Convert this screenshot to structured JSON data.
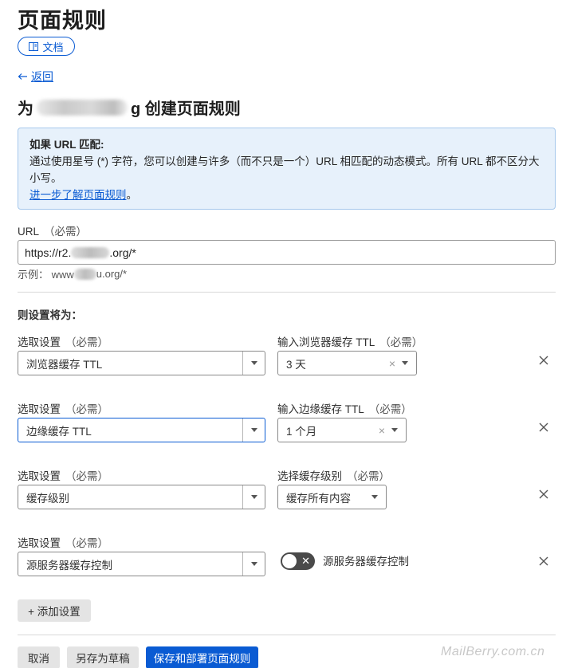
{
  "page": {
    "title": "页面规则",
    "docs_label": "文档",
    "back_label": "返回",
    "heading_prefix": "为",
    "heading_suffix": "g 创建页面规则"
  },
  "info": {
    "title": "如果 URL 匹配:",
    "body": "通过使用星号 (*) 字符，您可以创建与许多（而不只是一个）URL 相匹配的动态模式。所有 URL 都不区分大小写。",
    "link": "进一步了解页面规则",
    "link_tail": "。"
  },
  "url_field": {
    "label": "URL",
    "required": "（必需）",
    "value_prefix": "https://r2.",
    "value_suffix": ".org/*",
    "example_prefix": "示例：  www",
    "example_suffix": "u.org/*"
  },
  "settings": {
    "section_label": "则设置将为：",
    "pick_label": "选取设置",
    "required": "（必需）",
    "rows": [
      {
        "setting": "浏览器缓存 TTL",
        "value_label": "输入浏览器缓存 TTL",
        "value": "3 天"
      },
      {
        "setting": "边缘缓存 TTL",
        "value_label": "输入边缘缓存 TTL",
        "value": "1 个月"
      },
      {
        "setting": "缓存级别",
        "value_label": "选择缓存级别",
        "value": "缓存所有内容"
      },
      {
        "setting": "源服务器缓存控制",
        "toggle_label": "源服务器缓存控制",
        "toggle_on": false
      }
    ],
    "add_label": "+ 添加设置"
  },
  "footer": {
    "cancel": "取消",
    "save_draft": "另存为草稿",
    "save_deploy": "保存和部署页面规则"
  },
  "watermark": "MailBerry.com.cn",
  "colors": {
    "accent": "#0a5bd3",
    "info_bg": "#e7f1fb",
    "info_border": "#a6c8ec"
  },
  "icons": {
    "docs": "book-icon",
    "back": "arrow-left-icon",
    "dropdown": "chevron-down-icon",
    "remove": "close-icon"
  }
}
